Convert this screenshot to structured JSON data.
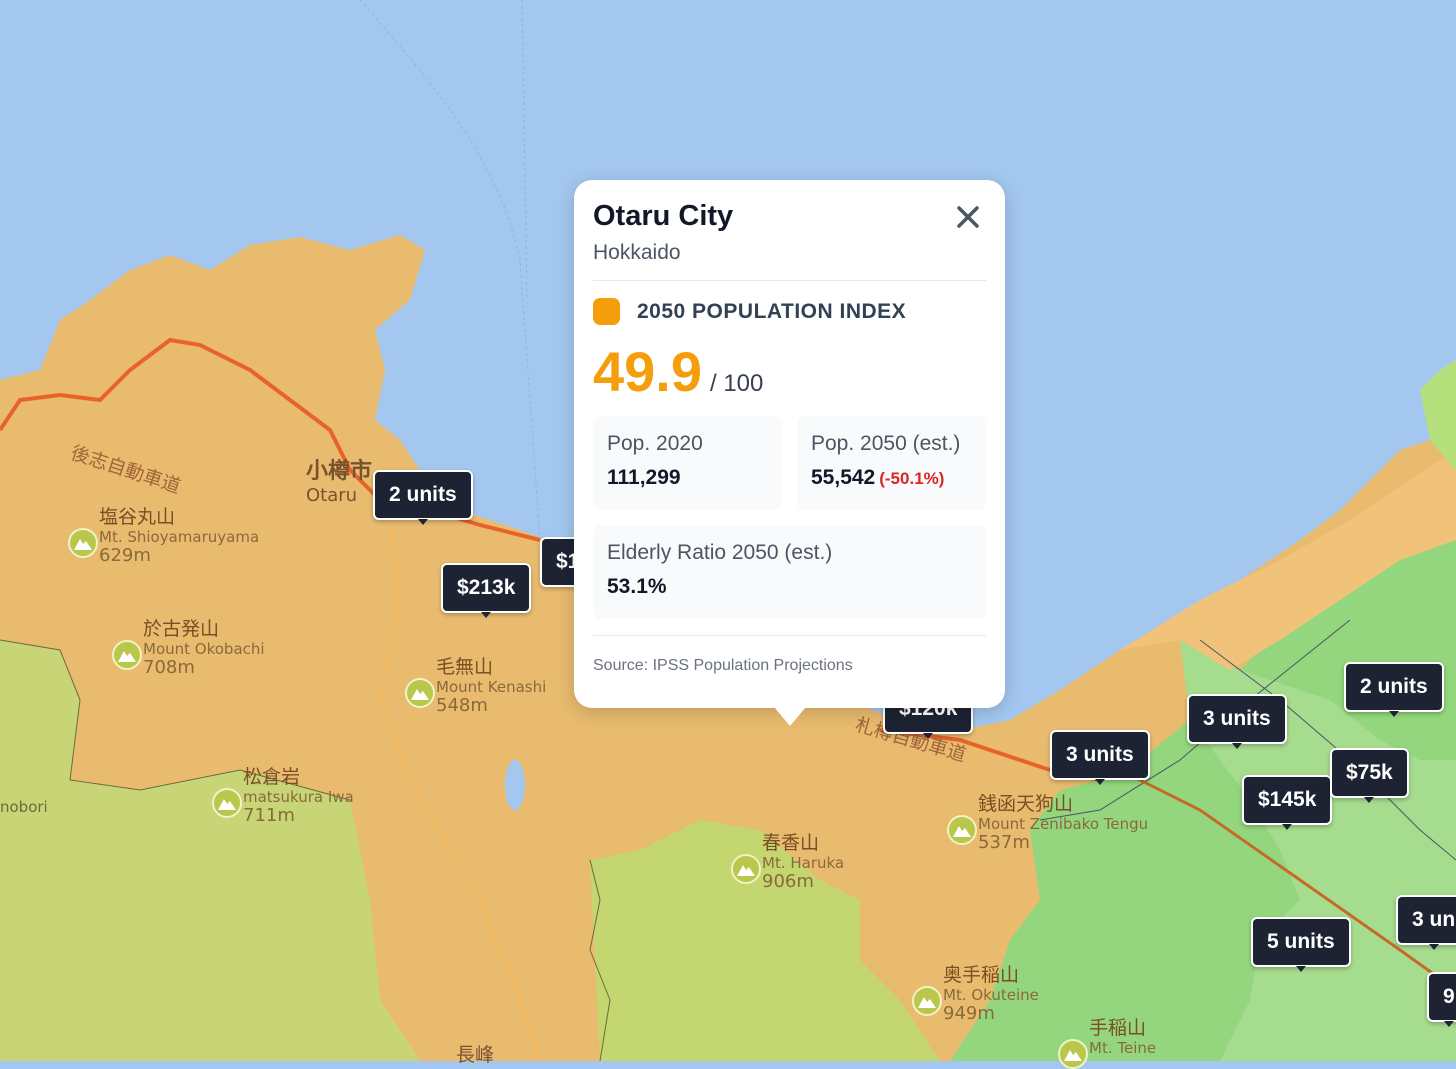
{
  "map": {
    "colors": {
      "sea": "#a3c7ef",
      "orange_zone": "#e9bb6f",
      "tan_zone": "#dcbe72",
      "yellow_green": "#c2d975",
      "green": "#8fd67c",
      "light_green": "#a8dc8f"
    },
    "places": [
      {
        "jp": "塩谷丸山",
        "en": "Mt. Shioyamaruyama",
        "elev": "629m"
      },
      {
        "jp": "於古発山",
        "en": "Mount Okobachi",
        "elev": "708m"
      },
      {
        "jp": "毛無山",
        "en": "Mount Kenashi",
        "elev": "548m"
      },
      {
        "jp": "松倉岩",
        "en": "matsukura Iwa",
        "elev": "711m"
      },
      {
        "jp": "春香山",
        "en": "Mt. Haruka",
        "elev": "906m"
      },
      {
        "jp": "銭函天狗山",
        "en": "Mount Zenibako Tengu",
        "elev": "537m"
      },
      {
        "jp": "奥手稲山",
        "en": "Mt. Okuteine",
        "elev": "949m"
      },
      {
        "jp": "手稲山",
        "en": "Mt. Teine",
        "elev": ""
      }
    ],
    "city": {
      "jp": "小樽市",
      "en": "Otaru"
    },
    "roads": [
      "後志自動車道",
      "札樽自動車道"
    ],
    "misc_labels": {
      "left_edge": "nobori",
      "bottom": "長峰"
    }
  },
  "markers": [
    {
      "label": "2 units"
    },
    {
      "label": "$213k"
    },
    {
      "label": "$1"
    },
    {
      "label": "$120k"
    },
    {
      "label": "3 units"
    },
    {
      "label": "3 units"
    },
    {
      "label": "2 units"
    },
    {
      "label": "$145k"
    },
    {
      "label": "$75k"
    },
    {
      "label": "5 units"
    },
    {
      "label": "3 un"
    },
    {
      "label": "9"
    }
  ],
  "popup": {
    "title": "Otaru City",
    "subtitle": "Hokkaido",
    "index_label": "2050 POPULATION INDEX",
    "index_color": "#f59e0b",
    "score": "49.9",
    "score_max": "/ 100",
    "pop2020_label": "Pop. 2020",
    "pop2020_value": "111,299",
    "pop2050_label": "Pop. 2050 (est.)",
    "pop2050_value": "55,542",
    "pop2050_change": "(-50.1%)",
    "elderly_label": "Elderly Ratio 2050 (est.)",
    "elderly_value": "53.1%",
    "source": "Source: IPSS Population Projections"
  }
}
